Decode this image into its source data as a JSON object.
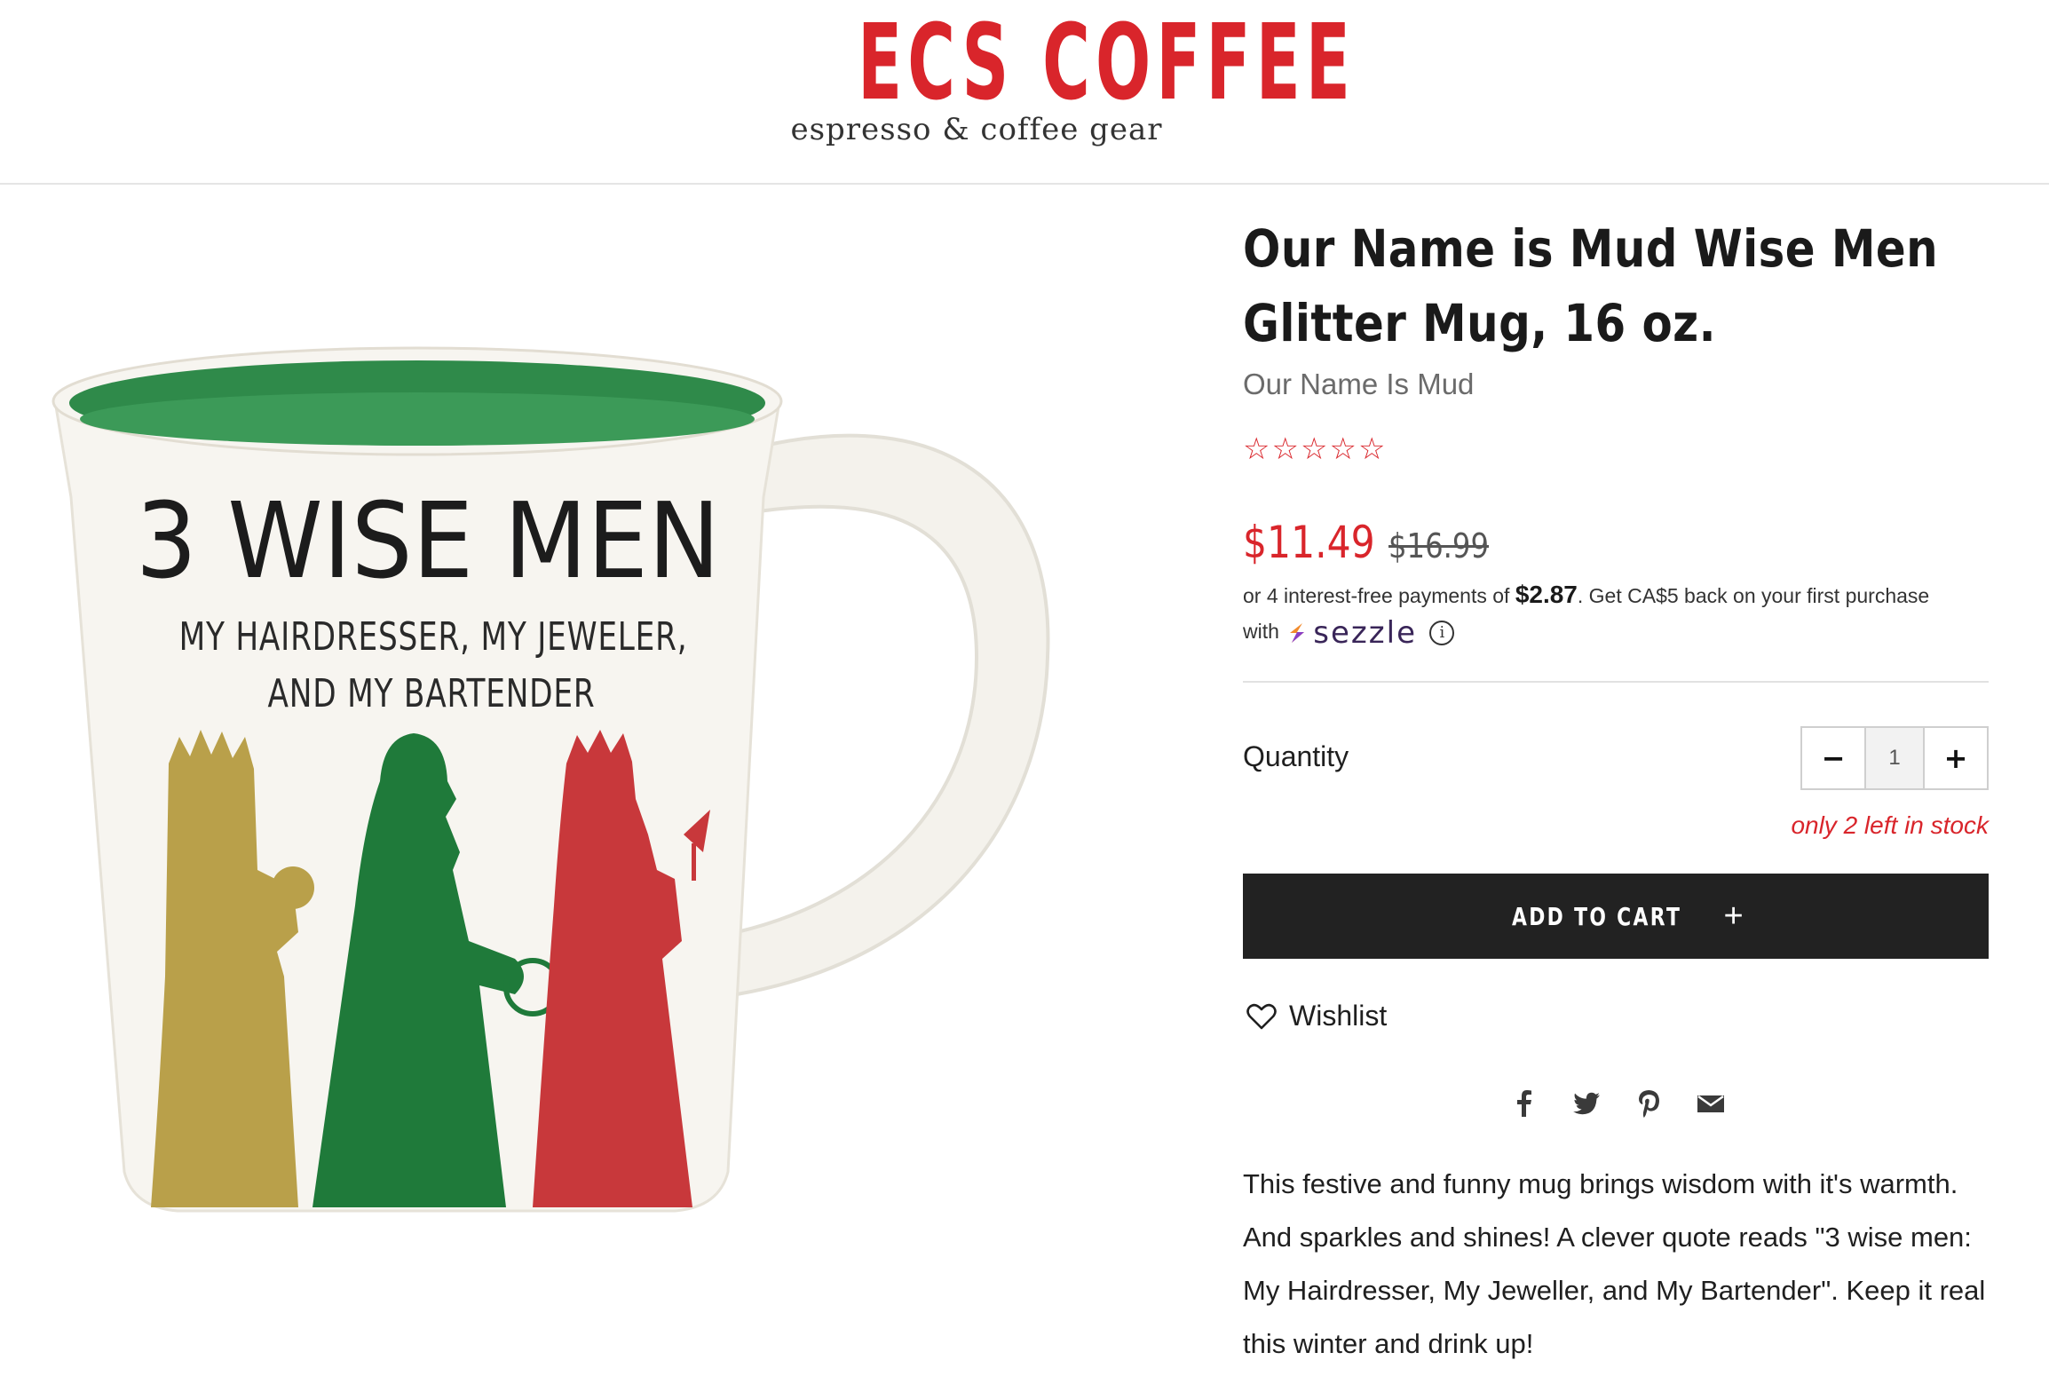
{
  "header": {
    "logo_word": "ECS COFFEE",
    "logo_tagline": "espresso & coffee gear",
    "brand_color": "#d9252b"
  },
  "product": {
    "image_alt": "3 Wise Men glitter mug",
    "mug_print": {
      "headline": "3 WISE MEN",
      "line1": "MY HAIRDRESSER, MY JEWELER,",
      "line2": "AND MY BARTENDER"
    },
    "title": "Our Name is Mud Wise Men Glitter Mug, 16 oz.",
    "vendor": "Our Name Is Mud",
    "rating": {
      "filled": 0,
      "max": 5,
      "star_glyph": "☆"
    },
    "price_sale": "$11.49",
    "price_compare": "$16.99",
    "sezzle": {
      "prefix": "or 4 interest-free payments of",
      "amount": "$2.87",
      "suffix": ". Get CA$5 back on your first purchase",
      "with": "with",
      "brand": "sezzle",
      "info_icon": "info-circle-icon",
      "info_glyph": "i"
    },
    "quantity": {
      "label": "Quantity",
      "minus": "−",
      "plus": "+",
      "value": "1"
    },
    "stock_note": "only 2 left in stock",
    "add_to_cart": {
      "label": "ADD TO CART",
      "icon": "+"
    },
    "wishlist_label": "Wishlist",
    "share_icons": [
      "facebook-icon",
      "twitter-icon",
      "pinterest-icon",
      "email-icon"
    ],
    "description": "This festive and funny mug brings wisdom with it's warmth. And sparkles and shines! A clever quote reads \"3 wise men: My Hairdresser, My Jeweller, and My Bartender\". Keep it real this winter and drink up!"
  },
  "colors": {
    "accent_red": "#d9252b",
    "button_dark": "#222222",
    "mug_green": "#2f8a4a",
    "glitter_gold": "#b9a04a",
    "glitter_green": "#1f7a3a",
    "glitter_red": "#c8383b"
  }
}
